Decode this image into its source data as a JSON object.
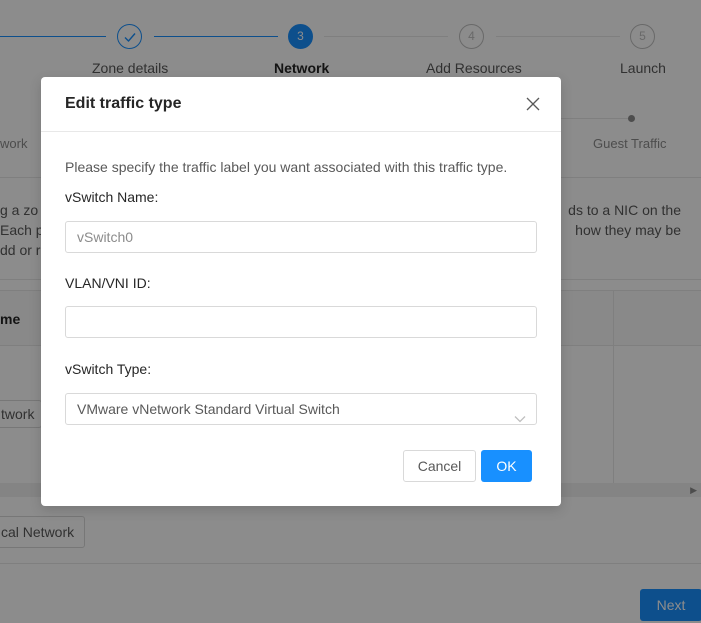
{
  "steps": [
    {
      "title": "Zone details",
      "number": "✓",
      "state": "done"
    },
    {
      "title": "Network",
      "number": "3",
      "state": "active"
    },
    {
      "title": "Add Resources",
      "number": "4",
      "state": "wait"
    },
    {
      "title": "Launch",
      "number": "5",
      "state": "wait"
    }
  ],
  "substeps": {
    "left_label": "work",
    "right_label": "Guest Traffic"
  },
  "description": {
    "left_line1": "g a zo",
    "left_line2": "Each ph",
    "left_line3": "dd or r",
    "right_line1": "ds to a NIC on the",
    "right_line2": "how they may be"
  },
  "table": {
    "header_label": "me",
    "network_button": "twork"
  },
  "background_buttons": {
    "add_physical_network": "cal Network",
    "next": "Next"
  },
  "modal": {
    "title": "Edit traffic type",
    "hint": "Please specify the traffic label you want associated with this traffic type.",
    "vswitch_name_label": "vSwitch Name:",
    "vswitch_name_placeholder": "vSwitch0",
    "vlan_label": "VLAN/VNI ID:",
    "vlan_value": "",
    "vswitch_type_label": "vSwitch Type:",
    "vswitch_type_value": "VMware vNetwork Standard Virtual Switch",
    "cancel_label": "Cancel",
    "ok_label": "OK"
  },
  "colors": {
    "primary": "#1890ff",
    "mask": "rgba(0,0,0,0.45)"
  }
}
